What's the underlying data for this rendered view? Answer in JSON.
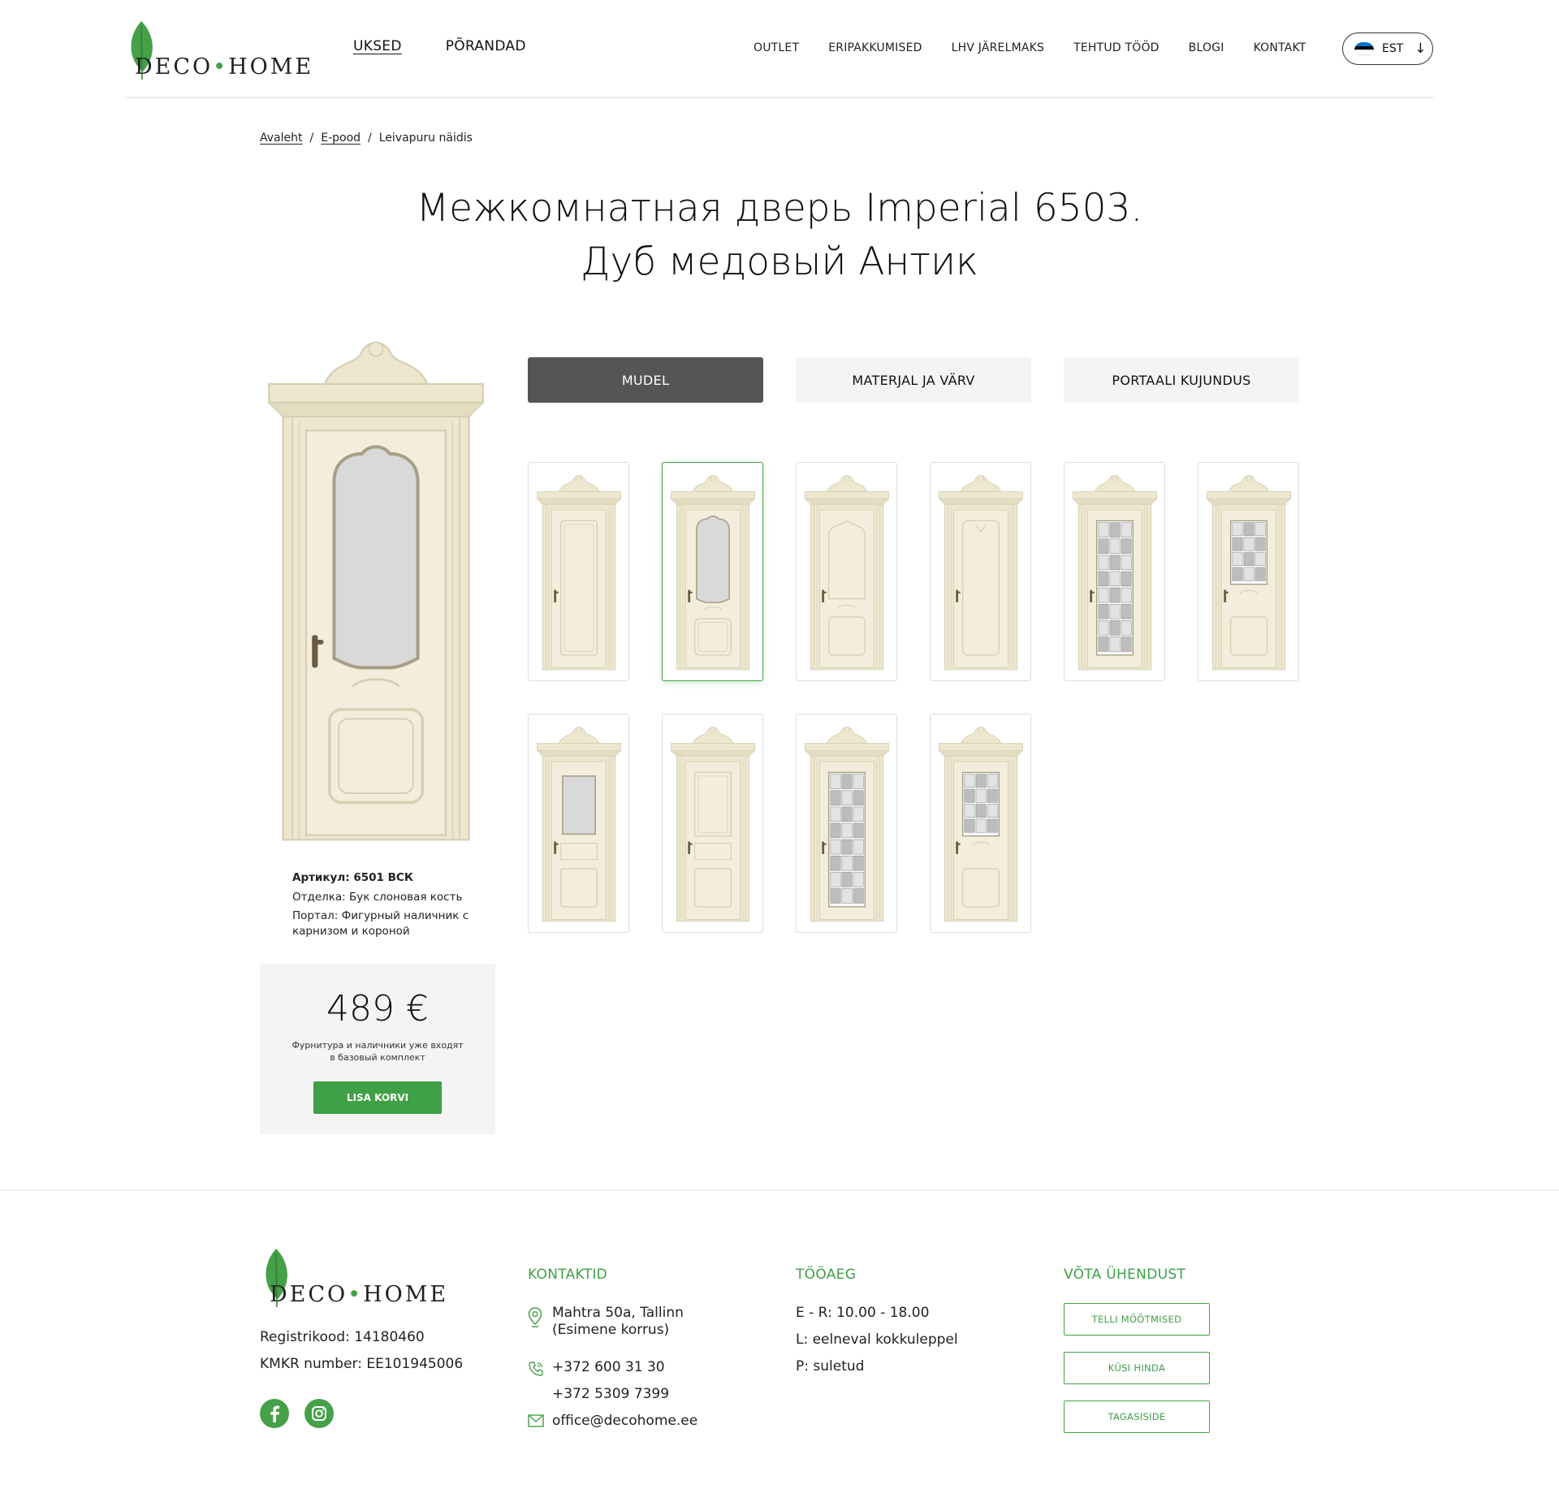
{
  "brand": {
    "logo_text_a": "D",
    "logo_text_b": "ECO",
    "logo_dot": "•",
    "logo_text_c": "HOME"
  },
  "header": {
    "main_nav": [
      "UKSED",
      "PÕRANDAD"
    ],
    "top_nav": [
      "OUTLET",
      "ERIPAKKUMISED",
      "LHV JÄRELMAKS",
      "TEHTUD TÖÖD",
      "BLOGI",
      "KONTAKT"
    ],
    "language": "EST",
    "language_arrow": "↓",
    "flag_colors": [
      "#0072ce",
      "#000000",
      "#ffffff"
    ]
  },
  "breadcrumb": {
    "items": [
      "Avaleht",
      "E-pood",
      "Leivapuru näidis"
    ],
    "separator": "/"
  },
  "product": {
    "title_line1": "Межкомнатная дверь Imperial 6503.",
    "title_line2": "Дуб медовый Антик",
    "sku": "Артикул: 6501 ВСК",
    "finish": "Отделка: Бук слоновая кость",
    "portal": "Портал: Фигурный наличник с карнизом и короной",
    "price": "489 €",
    "price_note": "Фурнитура и наличники уже входят в базовый комплект",
    "add_to_cart": "LISA KORVI"
  },
  "tabs": [
    {
      "label": "MUDEL",
      "active": true
    },
    {
      "label": "MATERJAL JA VÄRV",
      "active": false
    },
    {
      "label": "PORTAALI KUJUNDUS",
      "active": false
    }
  ],
  "models": [
    {
      "variant": "panel-plain",
      "selected": false
    },
    {
      "variant": "glass-arch",
      "selected": true
    },
    {
      "variant": "panel-arch",
      "selected": false
    },
    {
      "variant": "panel-tall",
      "selected": false
    },
    {
      "variant": "grid-full",
      "selected": false
    },
    {
      "variant": "grid-half",
      "selected": false
    },
    {
      "variant": "glass-rect",
      "selected": false
    },
    {
      "variant": "panel-rect",
      "selected": false
    },
    {
      "variant": "grid-full-narrow",
      "selected": false
    },
    {
      "variant": "grid-half-2",
      "selected": false
    }
  ],
  "colors": {
    "accent": "#45a047",
    "door": "#ede7cf",
    "door_shadow": "#d6cfb4",
    "glass": "#d9d9d9",
    "tab_active": "#555555",
    "panel_bg": "#f4f4f4"
  },
  "footer": {
    "reg_code": "Registrikood: 14180460",
    "kmkr": "KMKR number: EE101945006",
    "social": [
      "facebook-icon",
      "instagram-icon"
    ],
    "contacts_heading": "KONTAKTID",
    "address_line1": "Mahtra 50a, Tallinn",
    "address_line2": "(Esimene korrus)",
    "phone1": "+372 600 31 30",
    "phone2": "+372 5309 7399",
    "email": "office@decohome.ee",
    "hours_heading": "TÖÖAEG",
    "hours": [
      "E - R: 10.00 - 18.00",
      "L: eelneval kokkuleppel",
      "P: suletud"
    ],
    "connect_heading": "VÕTA ÜHENDUST",
    "buttons": [
      "TELLI MÕÕTMISED",
      "KÜSI HINDA",
      "TAGASISIDE"
    ]
  }
}
